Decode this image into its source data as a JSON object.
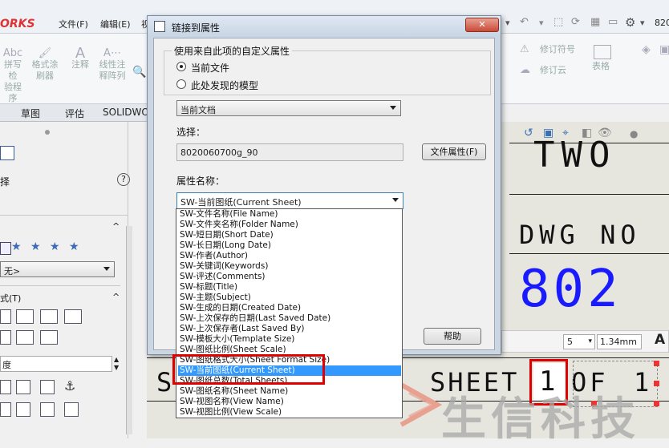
{
  "app": {
    "logo": "ORKS",
    "menus": [
      "文件(F)",
      "编辑(E)",
      "视"
    ],
    "right_label": "820",
    "ribbon_left": [
      {
        "line1": "拼写检",
        "line2": "验程序"
      },
      {
        "line1": "格式涂",
        "line2": "刷器"
      },
      {
        "line1": "注释",
        "line2": ""
      },
      {
        "line1": "线性注",
        "line2": "释阵列"
      }
    ],
    "ribbon_right": [
      {
        "label": "修订符号"
      },
      {
        "label": "修订云"
      },
      {
        "label": "表格"
      }
    ],
    "tabs": [
      "草图",
      "评估",
      "SOLIDWO"
    ]
  },
  "left_panel": {
    "heading": "择",
    "help": "?",
    "combo_value": "无>",
    "section_format": "式(T)",
    "field_label": "度"
  },
  "drawing": {
    "title_text": "TWO",
    "dwg_no_label": "DWG NO",
    "number_text": "802",
    "sheet_label": "SHEET",
    "sheet_current": "1",
    "sheet_of": "OF",
    "sheet_total": "1",
    "font_size_value": "5",
    "height_value": "1.34mm",
    "format_a": "A"
  },
  "dialog": {
    "title": "链接到属性",
    "group_label": "使用来自此项的自定义属性",
    "radio_current_file": "当前文件",
    "radio_model_found": "此处发现的模型",
    "doc_combo_value": "当前文档",
    "select_label": "选择：",
    "select_value": "8020060700g_90",
    "file_props_button": "文件属性(F)",
    "prop_name_label": "属性名称：",
    "prop_combo_value": "SW-当前图纸(Current Sheet)",
    "help_button": "帮助",
    "close_glyph": "✕",
    "options": [
      "SW-文件名称(File Name)",
      "SW-文件夹名称(Folder Name)",
      "SW-短日期(Short Date)",
      "SW-长日期(Long Date)",
      "SW-作者(Author)",
      "SW-关键词(Keywords)",
      "SW-评述(Comments)",
      "SW-标题(Title)",
      "SW-主题(Subject)",
      "SW-生成的日期(Created Date)",
      "SW-上次保存的日期(Last Saved Date)",
      "SW-上次保存者(Last Saved By)",
      "SW-模板大小(Template Size)",
      "SW-图纸比例(Sheet Scale)",
      "SW-图纸格式大小(Sheet Format Size)",
      "SW-当前图纸(Current Sheet)",
      "SW-图纸总数(Total Sheets)",
      "SW-图纸名称(Sheet Name)",
      "SW-视图名称(View Name)",
      "SW-视图比例(View Scale)"
    ],
    "selected_index": 15
  },
  "watermark": "生信科技",
  "colors": {
    "highlight_box": "#e00000",
    "selection": "#3399ff",
    "drawing_number": "#1a1aff"
  }
}
